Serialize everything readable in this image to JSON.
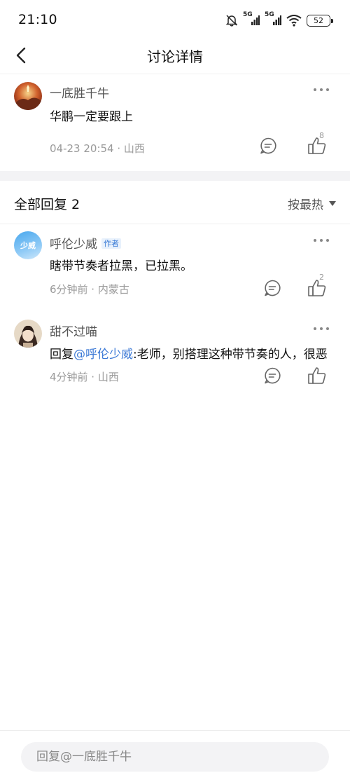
{
  "status_bar": {
    "time": "21:10",
    "battery": "52",
    "network_1": "5G",
    "network_2": "5G"
  },
  "nav": {
    "title": "讨论详情"
  },
  "main_comment": {
    "user": "一底胜千牛",
    "text": "华鹏一定要跟上",
    "meta": "04-23 20:54 · 山西",
    "like_count": "8"
  },
  "replies_header": {
    "title": "全部回复 2",
    "sort_label": "按最热"
  },
  "replies": [
    {
      "user": "呼伦少威",
      "author_tag": "作者",
      "avatar_text": "少威",
      "text": "瞎带节奏者拉黑，已拉黑。",
      "meta": "6分钟前 · 内蒙古",
      "like_count": "2"
    },
    {
      "user": "甜不过喵",
      "text_prefix": "回复",
      "mention": "@呼伦少威",
      "text_suffix": ":老师，别搭理这种带节奏的人，很恶",
      "meta": "4分钟前 · 山西"
    }
  ],
  "bottom": {
    "reply_placeholder": "回复@一底胜千牛"
  }
}
